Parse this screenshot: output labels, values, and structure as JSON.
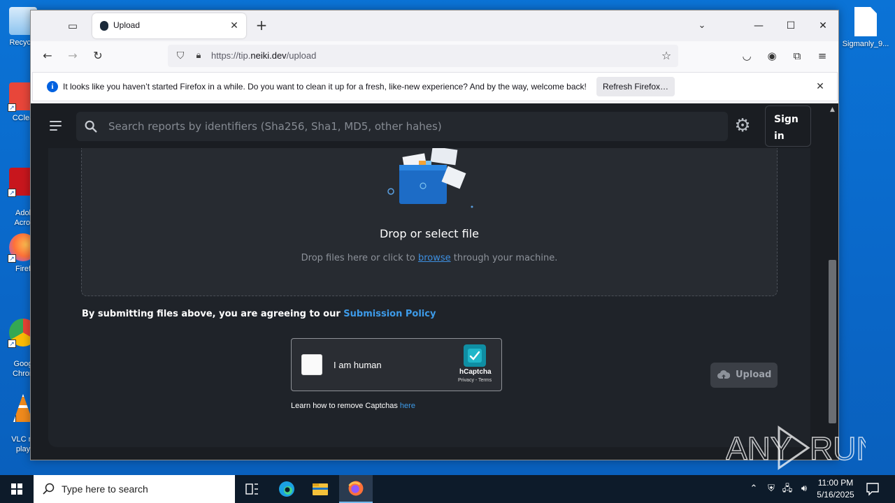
{
  "desktop": {
    "icons": [
      {
        "label": "Recycle",
        "color": "#6fb0e8"
      },
      {
        "label": "CClea",
        "color": "#e8463a"
      },
      {
        "label": "Adol\nAcrol",
        "color": "#c8161d"
      },
      {
        "label": "Firef",
        "color": "#ff7139"
      },
      {
        "label": "Goog\nChron",
        "color": "#34a853"
      },
      {
        "label": "VLC m\nplay",
        "color": "#f08a1c"
      },
      {
        "label": "Sigmanly_9...",
        "color": "#ffffff"
      }
    ]
  },
  "browser": {
    "tab": {
      "title": "Upload"
    },
    "url": {
      "prefix": "https://tip.",
      "domain": "neiki.dev",
      "path": "/upload"
    },
    "notification": {
      "message": "It looks like you haven’t started Firefox in a while. Do you want to clean it up for a fresh, like-new experience? And by the way, welcome back!",
      "button": "Refresh Firefox…"
    }
  },
  "page": {
    "search": {
      "placeholder": "Search reports by identifiers (Sha256, Sha1, MD5, other hahes)"
    },
    "signin": {
      "line1": "Sign",
      "line2": "in"
    },
    "dropzone": {
      "title": "Drop or select file",
      "sub_before": "Drop files here or click to ",
      "sub_link": "browse",
      "sub_after": " through your machine."
    },
    "policy": {
      "text": "By submitting files above, you are agreeing to our ",
      "link": "Submission Policy"
    },
    "captcha": {
      "label": "I am human",
      "brand": "hCaptcha",
      "links": "Privacy - Terms"
    },
    "learn": {
      "text": "Learn how to remove Captchas ",
      "link": "here"
    },
    "upload_button": "Upload"
  },
  "taskbar": {
    "search_placeholder": "Type here to search",
    "time": "11:00 PM",
    "date": "5/16/2025"
  },
  "watermark": {
    "text": "ANY RUN"
  },
  "colors": {
    "accent_link": "#3d9be9",
    "page_bg": "#1a1d22",
    "firefox_blue": "#0061e0"
  }
}
